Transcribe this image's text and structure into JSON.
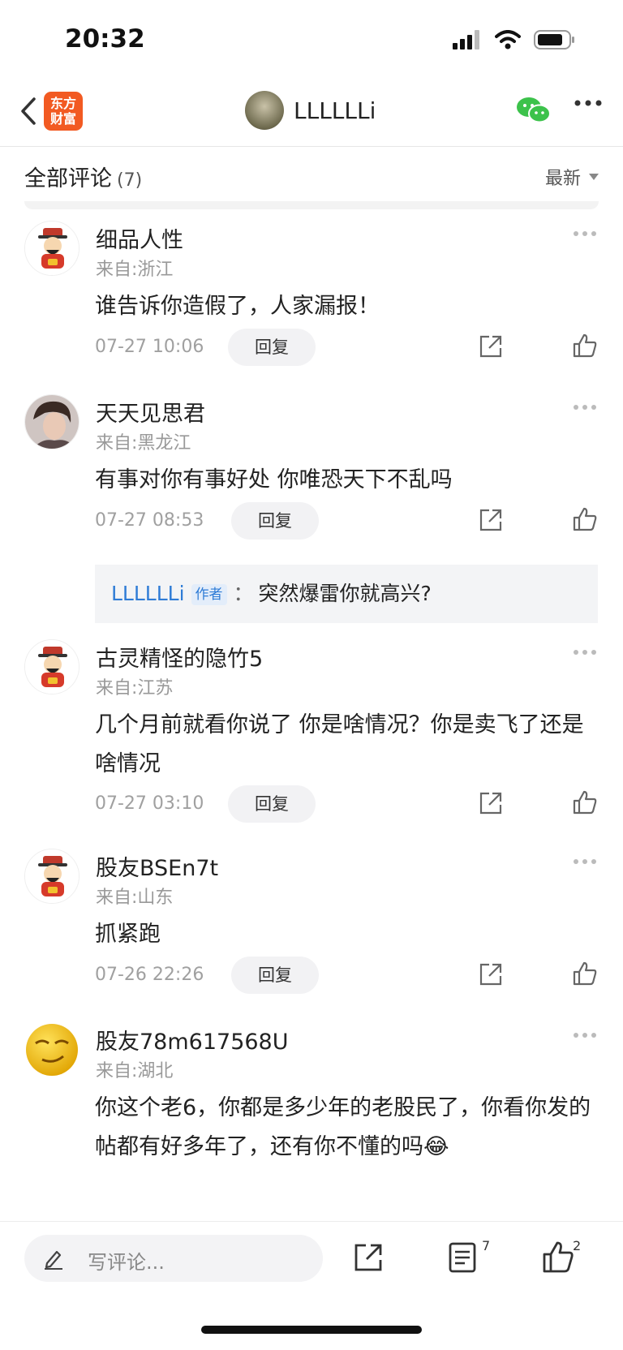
{
  "status": {
    "time": "20:32"
  },
  "nav": {
    "logo_line1": "东方",
    "logo_line2": "财富",
    "title": "LLLLLLi"
  },
  "sort": {
    "title": "全部评论",
    "count": "(7)",
    "order": "最新"
  },
  "reply_label": "回复",
  "comments": [
    {
      "name": "细品人性",
      "location": "来自:浙江",
      "text": "谁告诉你造假了，人家漏报！",
      "date": "07-27 10:06"
    },
    {
      "name": "天天见思君",
      "location": "来自:黑龙江",
      "text": "有事对你有事好处 你唯恐天下不乱吗",
      "date": "07-27 08:53",
      "sub_reply": {
        "author": "LLLLLLi",
        "badge": "作者",
        "colon": "：",
        "text": "突然爆雷你就高兴?"
      }
    },
    {
      "name": "古灵精怪的隐竹5",
      "location": "来自:江苏",
      "text": "几个月前就看你说了 你是啥情况？你是卖飞了还是啥情况",
      "date": "07-27 03:10"
    },
    {
      "name": "股友BSEn7t",
      "location": "来自:山东",
      "text": "抓紧跑",
      "date": "07-26 22:26"
    },
    {
      "name": "股友78m617568U",
      "location": "来自:湖北",
      "text": "你这个老6，你都是多少年的老股民了，你看你发的帖都有好多年了，还有你不懂的吗😂"
    }
  ],
  "bottom": {
    "placeholder": "写评论...",
    "comment_count": "7",
    "like_count": "2"
  }
}
